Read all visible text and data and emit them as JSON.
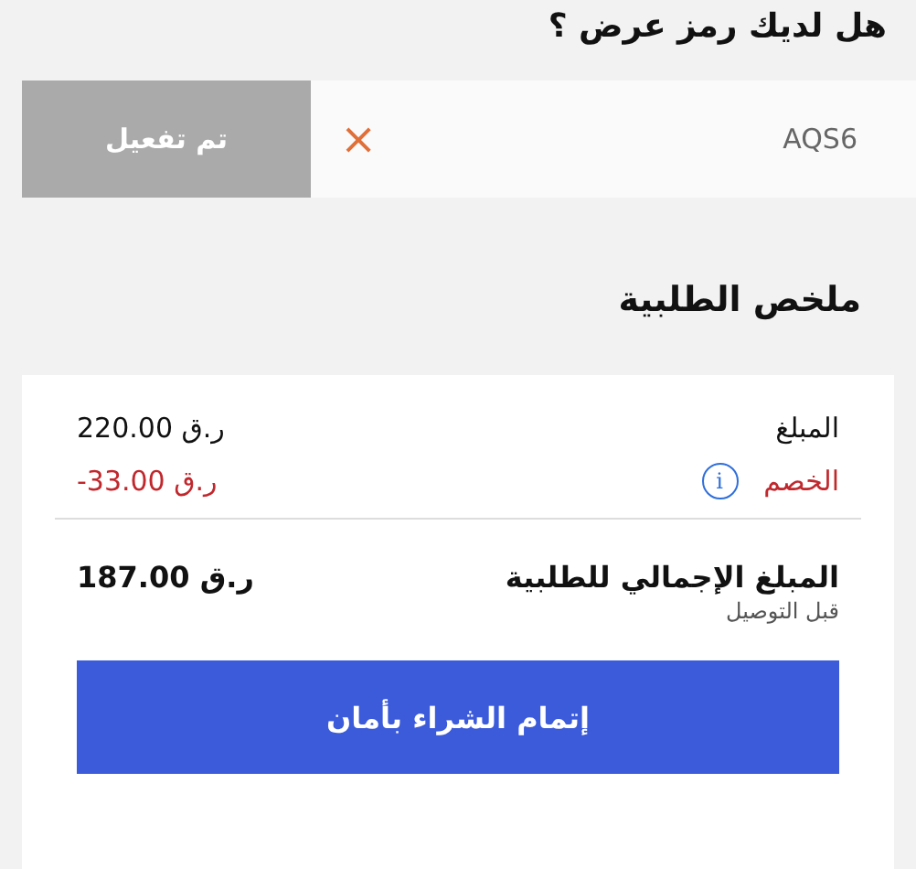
{
  "promo": {
    "title": "هل لديك رمز عرض ؟",
    "value": "AQS6",
    "clear": "×",
    "button": "تم تفعيل",
    "disabled": true
  },
  "summary": {
    "title": "ملخص الطلبية",
    "lines": [
      {
        "label": "المبلغ",
        "amount": "220.00 ر.ق",
        "kind": "plain"
      },
      {
        "label": "الخصم",
        "amount": "-33.00 ر.ق",
        "kind": "discount",
        "info": "i"
      }
    ],
    "total": {
      "label": "المبلغ الإجمالي للطلبية",
      "amount": "187.00 ر.ق",
      "note": "قبل التوصيل"
    },
    "checkout": "إتمام الشراء بأمان"
  }
}
